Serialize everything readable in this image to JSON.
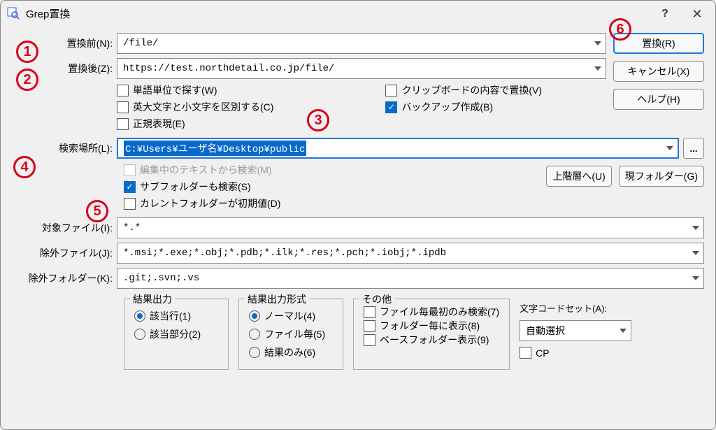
{
  "window": {
    "title": "Grep置換"
  },
  "labels": {
    "before": "置換前(N):",
    "after": "置換後(Z):",
    "location": "検索場所(L):",
    "target_file": "対象ファイル(I):",
    "exclude_file": "除外ファイル(J):",
    "exclude_folder": "除外フォルダー(K):"
  },
  "fields": {
    "before": "/file/",
    "after": "https://test.northdetail.co.jp/file/",
    "location": "C:¥Users¥ユーザ名¥Desktop¥public",
    "target_file": "*.*",
    "exclude_file": "*.msi;*.exe;*.obj;*.pdb;*.ilk;*.res;*.pch;*.iobj;*.ipdb",
    "exclude_folder": ".git;.svn;.vs"
  },
  "checks": {
    "word_unit": "単語単位で探す(W)",
    "case": "英大文字と小文字を区別する(C)",
    "regex": "正規表現(E)",
    "clipboard": "クリップボードの内容で置換(V)",
    "backup": "バックアップ作成(B)",
    "from_editing": "編集中のテキストから検索(M)",
    "subfolder": "サブフォルダーも検索(S)",
    "current_default": "カレントフォルダーが初期値(D)"
  },
  "buttons": {
    "replace": "置換(R)",
    "cancel": "キャンセル(X)",
    "help": "ヘルプ(H)",
    "browse": "...",
    "up_dir": "上階層へ(U)",
    "cur_dir": "現フォルダー(G)"
  },
  "fieldsets": {
    "output": {
      "legend": "結果出力",
      "opt1": "該当行(1)",
      "opt2": "該当部分(2)"
    },
    "format": {
      "legend": "結果出力形式",
      "opt1": "ノーマル(4)",
      "opt2": "ファイル毎(5)",
      "opt3": "結果のみ(6)"
    },
    "other": {
      "legend": "その他",
      "opt1": "ファイル毎最初のみ検索(7)",
      "opt2": "フォルダー毎に表示(8)",
      "opt3": "ベースフォルダー表示(9)"
    },
    "charset": {
      "label": "文字コードセット(A):",
      "value": "自動選択",
      "cp": "CP"
    }
  },
  "annotations": {
    "n1": "1",
    "n2": "2",
    "n3": "3",
    "n4": "4",
    "n5": "5",
    "n6": "6"
  }
}
